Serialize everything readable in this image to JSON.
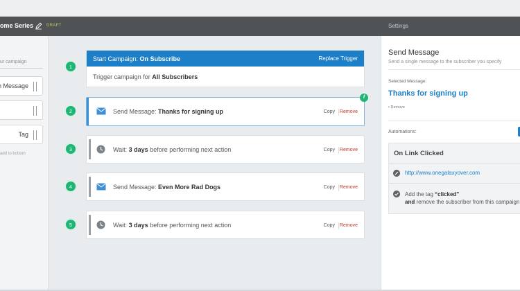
{
  "header": {
    "title": "ome Series",
    "draft": "DRAFT",
    "settings": "Settings"
  },
  "palette": {
    "hint": "ur campaign",
    "items": [
      {
        "label": "n Message"
      },
      {
        "label": ""
      },
      {
        "label": "Tag"
      }
    ],
    "add_to_bottom": "add to bottom"
  },
  "steps": [
    {
      "num": "1"
    },
    {
      "num": "2"
    },
    {
      "num": "3"
    },
    {
      "num": "4"
    },
    {
      "num": "5"
    }
  ],
  "trigger": {
    "prefix": "Start Campaign: ",
    "name": "On Subscribe",
    "replace": "Replace Trigger",
    "body_prefix": "Trigger campaign for ",
    "body_bold": "All Subscribers"
  },
  "actions": [
    {
      "prefix": "Send Message: ",
      "bold": "Thanks for signing up",
      "suffix": "",
      "icon": "envelope-icon"
    },
    {
      "prefix": "Wait: ",
      "bold": "3 days",
      "suffix": " before performing next action",
      "icon": "clock-icon"
    },
    {
      "prefix": "Send Message: ",
      "bold": "Even More Rad Dogs",
      "suffix": "",
      "icon": "envelope-icon"
    },
    {
      "prefix": "Wait: ",
      "bold": "3 days",
      "suffix": " before performing next action",
      "icon": "clock-icon"
    }
  ],
  "card_actions": {
    "copy": "Copy",
    "remove": "Remove"
  },
  "badge": "f",
  "settings_panel": {
    "title": "Send Message",
    "subtitle": "Send a single message to the subscriber you specify",
    "selected_label": "Selected Message:",
    "selected_value": "Thanks for signing up",
    "remove": "Remove",
    "automations_label": "Automations:",
    "automation": {
      "heading": "On Link Clicked",
      "link": "http://www.onegalaxyover.com",
      "tag_prefix": "Add the tag ",
      "tag_name": "“clicked”",
      "and": "and",
      "remove_text": " remove the subscriber from this campaign"
    }
  },
  "colors": {
    "header": "#4f5355",
    "accent_blue": "#1e7fc9",
    "step_green": "#1fb574",
    "remove_red": "#c0392b"
  }
}
